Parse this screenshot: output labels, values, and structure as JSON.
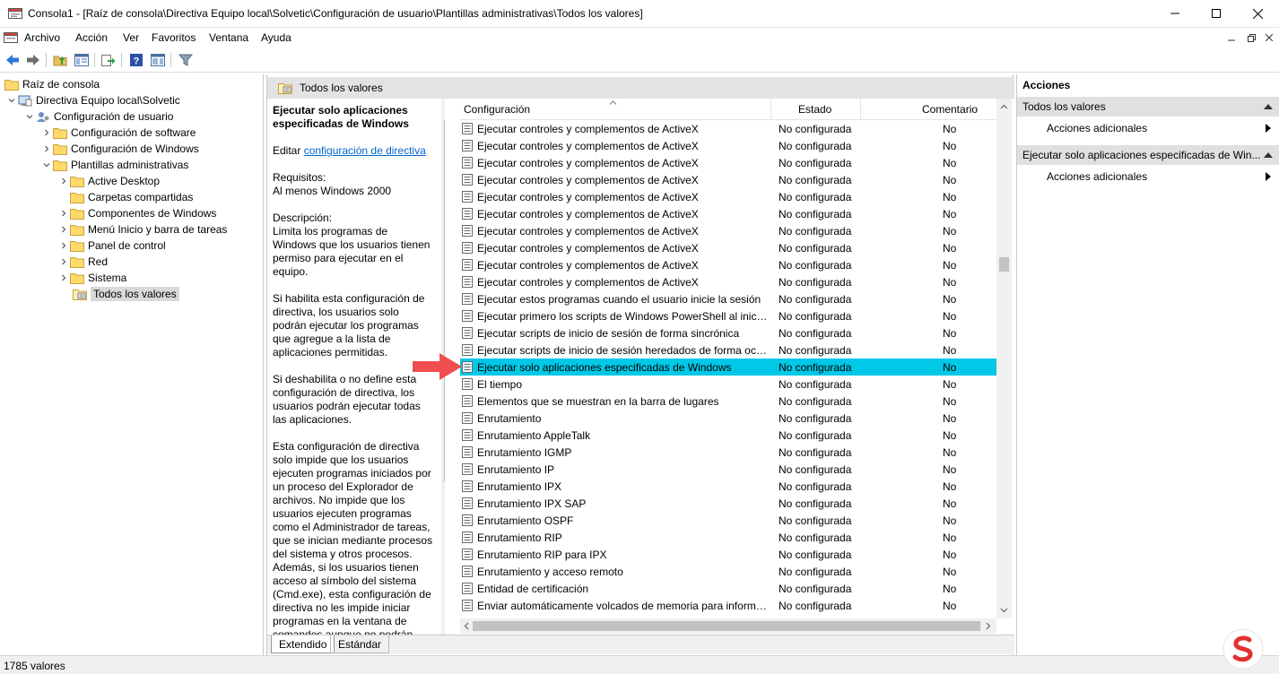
{
  "window": {
    "title": "Consola1 - [Raíz de consola\\Directiva Equipo local\\Solvetic\\Configuración de usuario\\Plantillas administrativas\\Todos los valores]"
  },
  "menu": {
    "items": [
      "Archivo",
      "Acción",
      "Ver",
      "Favoritos",
      "Ventana",
      "Ayuda"
    ]
  },
  "tree": {
    "items": [
      {
        "label": "Raíz de consola"
      },
      {
        "label": "Directiva Equipo local\\Solvetic"
      },
      {
        "label": "Configuración de usuario"
      },
      {
        "label": "Configuración de software"
      },
      {
        "label": "Configuración de Windows"
      },
      {
        "label": "Plantillas administrativas"
      },
      {
        "label": "Active Desktop"
      },
      {
        "label": "Carpetas compartidas"
      },
      {
        "label": "Componentes de Windows"
      },
      {
        "label": "Menú Inicio y barra de tareas"
      },
      {
        "label": "Panel de control"
      },
      {
        "label": "Red"
      },
      {
        "label": "Sistema"
      },
      {
        "label": "Todos los valores"
      }
    ]
  },
  "middle": {
    "header_title": "Todos los valores",
    "description": {
      "title": "Ejecutar solo aplicaciones especificadas de Windows",
      "edit_prefix": "Editar ",
      "edit_link": "configuración de directiva",
      "requirements_label": "Requisitos:",
      "requirements_value": "Al menos Windows 2000",
      "description_label": "Descripción:",
      "p1": "Limita los programas de Windows que los usuarios tienen permiso para ejecutar en el equipo.",
      "p2": "Si habilita esta configuración de directiva, los usuarios solo podrán ejecutar los programas que agregue a la lista de aplicaciones permitidas.",
      "p3": "Si deshabilita o no define esta configuración de directiva, los usuarios podrán ejecutar todas las aplicaciones.",
      "p4": "Esta configuración de directiva solo impide que los usuarios ejecuten programas iniciados por un proceso del Explorador de archivos.  No impide que los usuarios ejecuten programas como el Administrador de tareas, que se inician mediante procesos del sistema y otros procesos. Además, si los usuarios tienen acceso al símbolo del sistema (Cmd.exe), esta configuración de directiva no les impide iniciar programas en la ventana de comandos aunque no podrán"
    },
    "columns": {
      "name": "Configuración",
      "state": "Estado",
      "comment": "Comentario"
    },
    "rows": [
      {
        "name": "Ejecutar controles y complementos de ActiveX",
        "state": "No configurada",
        "comment": "No"
      },
      {
        "name": "Ejecutar controles y complementos de ActiveX",
        "state": "No configurada",
        "comment": "No"
      },
      {
        "name": "Ejecutar controles y complementos de ActiveX",
        "state": "No configurada",
        "comment": "No"
      },
      {
        "name": "Ejecutar controles y complementos de ActiveX",
        "state": "No configurada",
        "comment": "No"
      },
      {
        "name": "Ejecutar controles y complementos de ActiveX",
        "state": "No configurada",
        "comment": "No"
      },
      {
        "name": "Ejecutar controles y complementos de ActiveX",
        "state": "No configurada",
        "comment": "No"
      },
      {
        "name": "Ejecutar controles y complementos de ActiveX",
        "state": "No configurada",
        "comment": "No"
      },
      {
        "name": "Ejecutar controles y complementos de ActiveX",
        "state": "No configurada",
        "comment": "No"
      },
      {
        "name": "Ejecutar controles y complementos de ActiveX",
        "state": "No configurada",
        "comment": "No"
      },
      {
        "name": "Ejecutar controles y complementos de ActiveX",
        "state": "No configurada",
        "comment": "No"
      },
      {
        "name": "Ejecutar estos programas cuando el usuario inicie la sesión",
        "state": "No configurada",
        "comment": "No"
      },
      {
        "name": "Ejecutar primero los scripts de Windows PowerShell al inicia...",
        "state": "No configurada",
        "comment": "No"
      },
      {
        "name": "Ejecutar scripts de inicio de sesión de forma sincrónica",
        "state": "No configurada",
        "comment": "No"
      },
      {
        "name": "Ejecutar scripts de inicio de sesión heredados de forma oculta",
        "state": "No configurada",
        "comment": "No"
      },
      {
        "name": "Ejecutar solo aplicaciones especificadas de Windows",
        "state": "No configurada",
        "comment": "No"
      },
      {
        "name": "El tiempo",
        "state": "No configurada",
        "comment": "No"
      },
      {
        "name": "Elementos que se muestran en la barra de lugares",
        "state": "No configurada",
        "comment": "No"
      },
      {
        "name": "Enrutamiento",
        "state": "No configurada",
        "comment": "No"
      },
      {
        "name": "Enrutamiento AppleTalk",
        "state": "No configurada",
        "comment": "No"
      },
      {
        "name": "Enrutamiento IGMP",
        "state": "No configurada",
        "comment": "No"
      },
      {
        "name": "Enrutamiento IP",
        "state": "No configurada",
        "comment": "No"
      },
      {
        "name": "Enrutamiento IPX",
        "state": "No configurada",
        "comment": "No"
      },
      {
        "name": "Enrutamiento IPX SAP",
        "state": "No configurada",
        "comment": "No"
      },
      {
        "name": "Enrutamiento OSPF",
        "state": "No configurada",
        "comment": "No"
      },
      {
        "name": "Enrutamiento RIP",
        "state": "No configurada",
        "comment": "No"
      },
      {
        "name": "Enrutamiento RIP para IPX",
        "state": "No configurada",
        "comment": "No"
      },
      {
        "name": "Enrutamiento y acceso remoto",
        "state": "No configurada",
        "comment": "No"
      },
      {
        "name": "Entidad de certificación",
        "state": "No configurada",
        "comment": "No"
      },
      {
        "name": "Enviar automáticamente volcados de memoria para informe...",
        "state": "No configurada",
        "comment": "No"
      }
    ],
    "selected_row": 14,
    "tabs": [
      "Extendido",
      "Estándar"
    ]
  },
  "actions": {
    "title": "Acciones",
    "group1": "Todos los valores",
    "group1_item": "Acciones adicionales",
    "group2": "Ejecutar solo aplicaciones especificadas de Win...",
    "group2_item": "Acciones adicionales"
  },
  "status": {
    "text": "1785 valores"
  },
  "colors": {
    "selection": "#00c8e6",
    "arrow": "#f04e4e",
    "link": "#0066cc"
  }
}
